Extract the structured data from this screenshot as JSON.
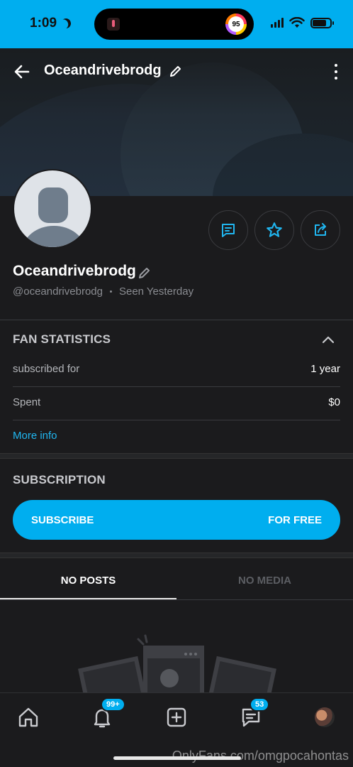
{
  "status_bar": {
    "time": "1:09",
    "activity_value": "95"
  },
  "header": {
    "title": "Oceandrivebrodg"
  },
  "profile": {
    "name": "Oceandrivebrodg",
    "handle": "@oceandrivebrodg",
    "seen": "Seen  Yesterday"
  },
  "fan_statistics": {
    "title": "FAN STATISTICS",
    "rows": [
      {
        "label": "subscribed for",
        "value": "1 year"
      },
      {
        "label": "Spent",
        "value": "$0"
      }
    ],
    "more_info": "More info"
  },
  "subscription": {
    "title": "SUBSCRIPTION",
    "button_left": "SUBSCRIBE",
    "button_right": "FOR FREE"
  },
  "tabs": [
    {
      "label": "NO POSTS",
      "active": true
    },
    {
      "label": "NO MEDIA",
      "active": false
    }
  ],
  "bottom_nav": {
    "notifications_badge": "99+",
    "messages_badge": "53"
  },
  "watermark": "OnlyFans.com/omgpocahontas",
  "colors": {
    "accent": "#00aeef",
    "background": "#1b1b1d"
  }
}
